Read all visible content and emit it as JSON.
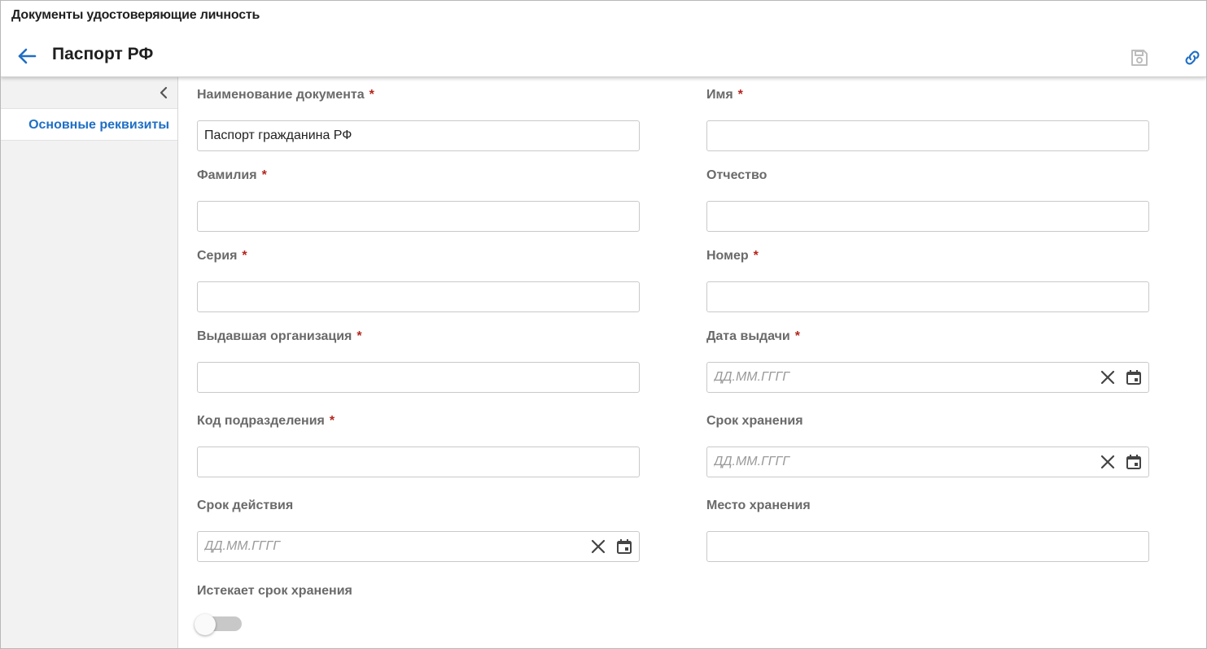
{
  "window": {
    "breadcrumb": "Документы удостоверяющие личность"
  },
  "header": {
    "title": "Паспорт РФ"
  },
  "sidebar": {
    "items": [
      {
        "label": "Основные реквизиты"
      }
    ]
  },
  "form": {
    "doc_name": {
      "label": "Наименование документа",
      "required": "*",
      "value": "Паспорт гражданина РФ"
    },
    "first_name": {
      "label": "Имя",
      "required": "*",
      "value": ""
    },
    "last_name": {
      "label": "Фамилия",
      "required": "*",
      "value": ""
    },
    "patronymic": {
      "label": "Отчество",
      "value": ""
    },
    "series": {
      "label": "Серия",
      "required": "*",
      "value": ""
    },
    "number": {
      "label": "Номер",
      "required": "*",
      "value": ""
    },
    "issuer": {
      "label": "Выдавшая организация",
      "required": "*",
      "value": ""
    },
    "issue_date": {
      "label": "Дата выдачи",
      "required": "*",
      "placeholder": "ДД.ММ.ГГГГ"
    },
    "division_code": {
      "label": "Код подразделения",
      "required": "*",
      "value": ""
    },
    "storage_term": {
      "label": "Срок хранения",
      "placeholder": "ДД.ММ.ГГГГ"
    },
    "validity_term": {
      "label": "Срок действия",
      "placeholder": "ДД.ММ.ГГГГ"
    },
    "storage_place": {
      "label": "Место хранения",
      "value": ""
    },
    "storage_expires": {
      "label": "Истекает срок хранения",
      "checked": false
    }
  },
  "colors": {
    "accent": "#1f6fc5",
    "required": "#b3261e",
    "label": "#6a6a6a"
  }
}
